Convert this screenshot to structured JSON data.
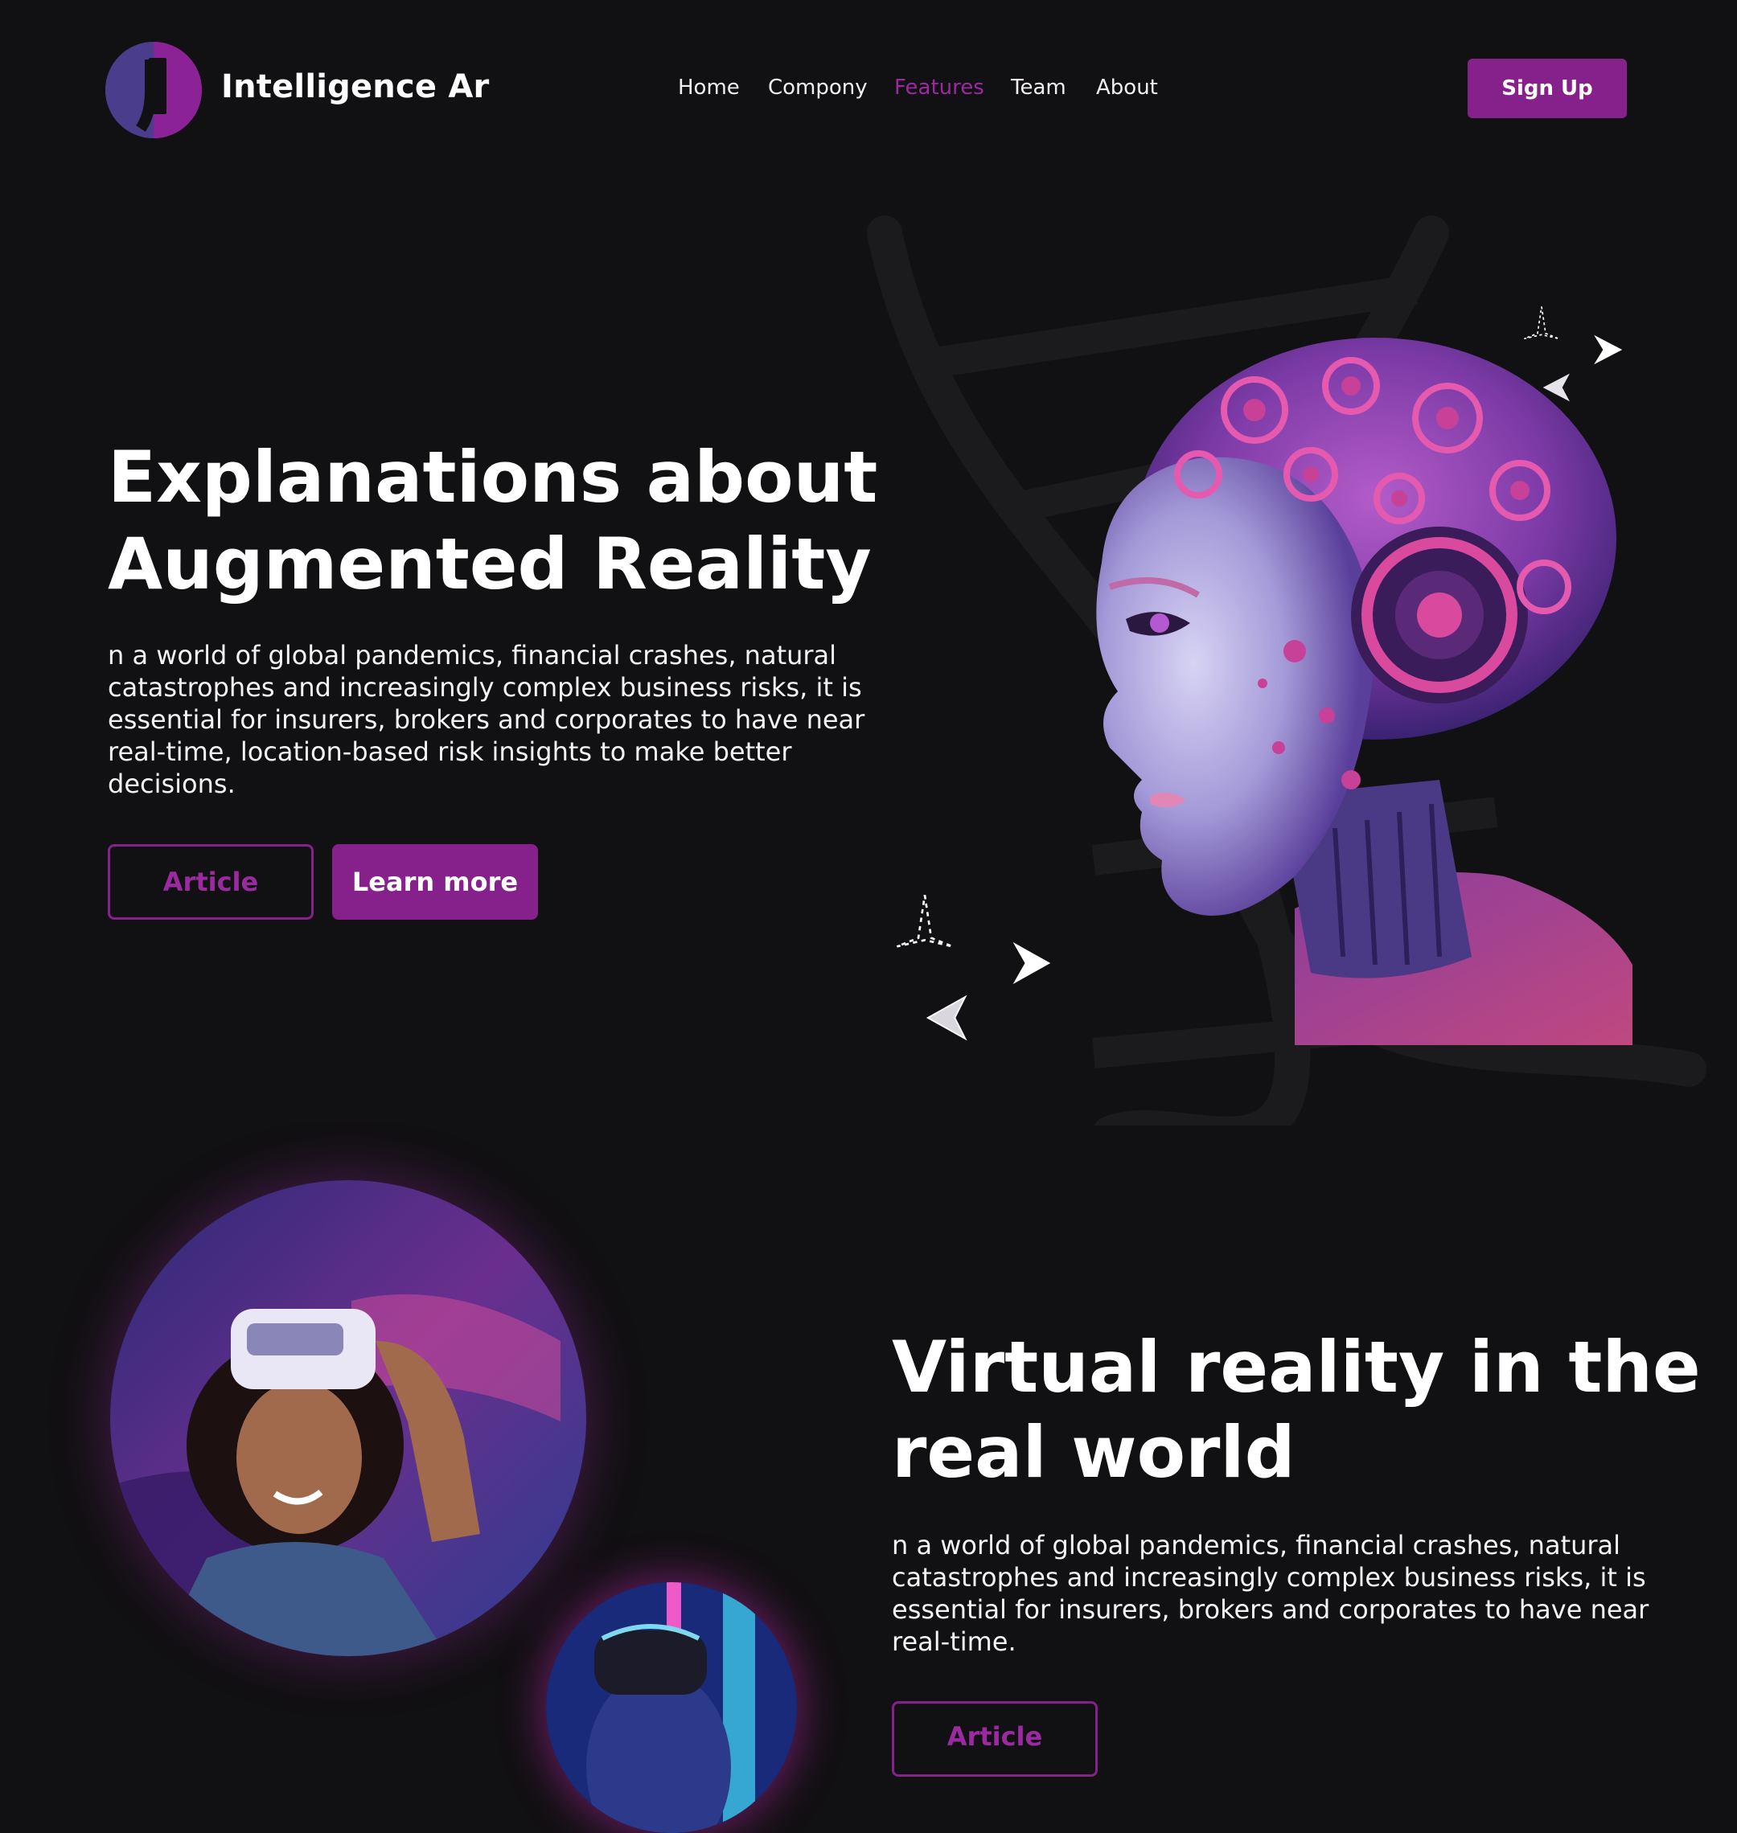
{
  "header": {
    "brand": "Intelligence Ar",
    "nav": [
      {
        "label": "Home"
      },
      {
        "label": "Compony"
      },
      {
        "label": "Features",
        "active": true
      },
      {
        "label": "Team"
      },
      {
        "label": "About"
      }
    ],
    "signup_label": "Sign Up"
  },
  "hero": {
    "title_line1": "Explanations about",
    "title_line2": "Augmented Reality",
    "body_lines": [
      "n a world of global pandemics, financial crashes, natural",
      "catastrophes and increasingly complex business risks, it is",
      "essential for insurers, brokers and corporates to have near",
      "real-time, location-based risk insights to make better",
      "decisions."
    ],
    "article_label": "Article",
    "learn_more_label": "Learn more"
  },
  "vr_section": {
    "title_line1": "Virtual reality in the",
    "title_line2": "real world",
    "body_lines": [
      "n a world of global pandemics, financial crashes, natural",
      "catastrophes and increasingly complex business risks, it is",
      "essential for insurers, brokers and corporates to have near",
      "real-time."
    ],
    "article_label": "Article"
  },
  "colors": {
    "background": "#111012",
    "accent": "#86208b",
    "accent_text": "#9b2aa1",
    "logo_dark": "#4a3d8c"
  },
  "icons": [
    "logo-mark",
    "sparkle-outline",
    "sparkle-solid"
  ]
}
